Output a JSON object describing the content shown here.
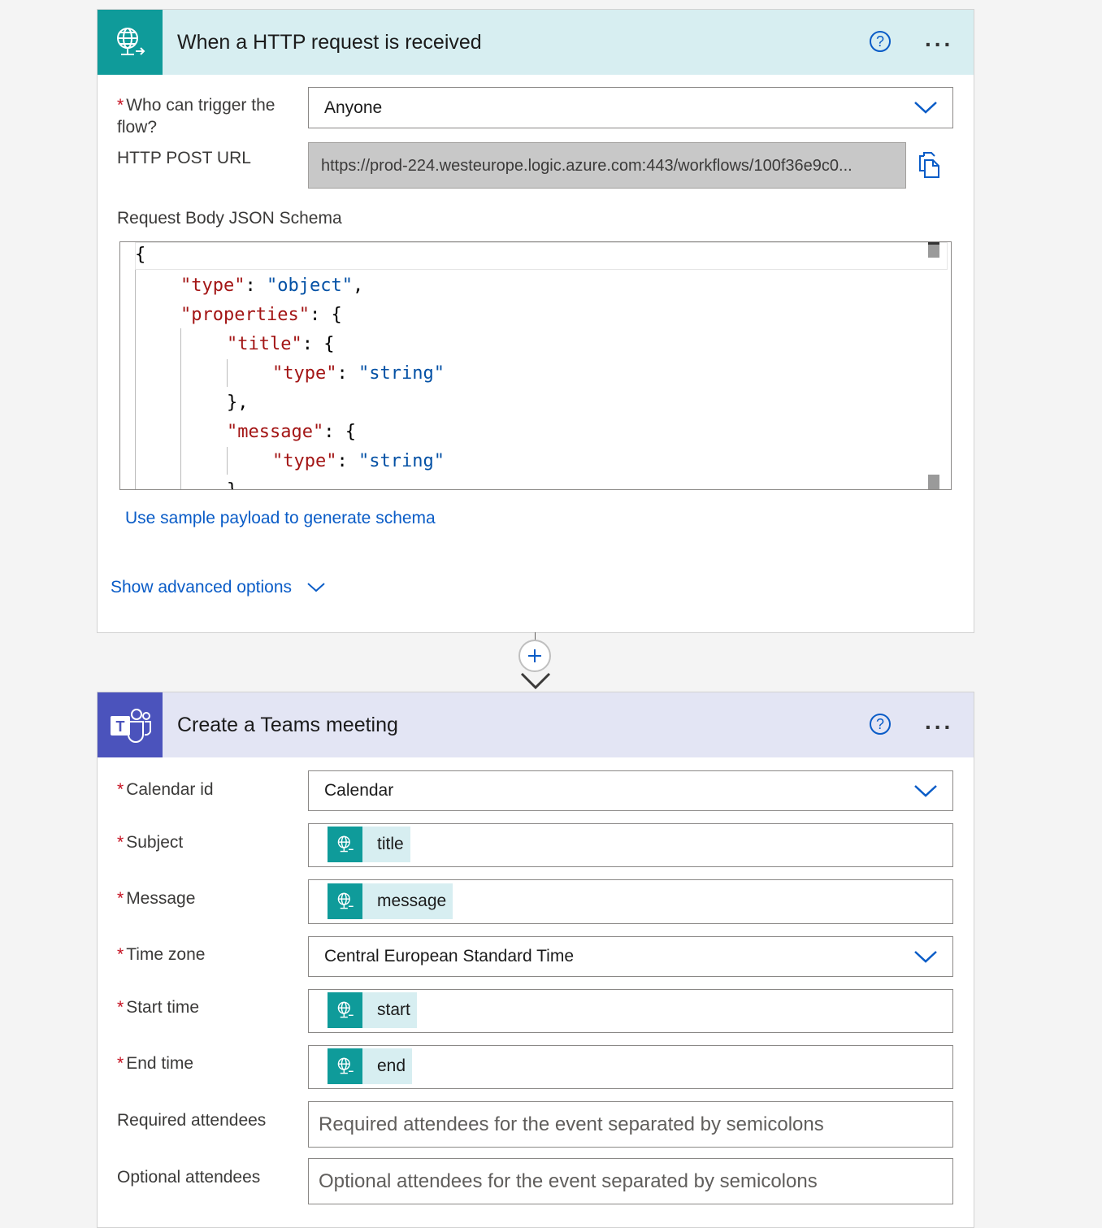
{
  "trigger_card": {
    "title": "When a HTTP request is received",
    "help_label": "?",
    "more_label": "...",
    "who_label": "Who can trigger the flow?",
    "who_value": "Anyone",
    "url_label": "HTTP POST URL",
    "url_value": "https://prod-224.westeurope.logic.azure.com:443/workflows/100f36e9c0...",
    "schema_label": "Request Body JSON Schema",
    "schema_lines": [
      "{",
      "\"type\": \"object\",",
      "\"properties\": {",
      "\"title\": {",
      "\"type\": \"string\"",
      "},",
      "\"message\": {",
      "\"type\": \"string\"",
      "}"
    ],
    "sample_link": "Use sample payload to generate schema",
    "advanced_link": "Show advanced options"
  },
  "teams_card": {
    "title": "Create a Teams meeting",
    "help_label": "?",
    "more_label": "...",
    "fields": {
      "calendar_label": "Calendar id",
      "calendar_value": "Calendar",
      "subject_label": "Subject",
      "subject_token": "title",
      "message_label": "Message",
      "message_token": "message",
      "timezone_label": "Time zone",
      "timezone_value": "Central European Standard Time",
      "start_label": "Start time",
      "start_token": "start",
      "end_label": "End time",
      "end_token": "end",
      "required_label": "Required attendees",
      "required_placeholder": "Required attendees for the event separated by semicolons",
      "optional_label": "Optional attendees",
      "optional_placeholder": "Optional attendees for the event separated by semicolons"
    }
  },
  "connector": {
    "plus_label": "+"
  },
  "colors": {
    "http_teal": "#0f9b9a",
    "teams_purple": "#4b53bc",
    "link_blue": "#0a5cc7",
    "required_red": "#c50f1f"
  },
  "icons": [
    "globe-request-icon",
    "teams-icon",
    "help-icon",
    "more-icon",
    "chevron-down-icon",
    "copy-icon",
    "plus-icon"
  ]
}
